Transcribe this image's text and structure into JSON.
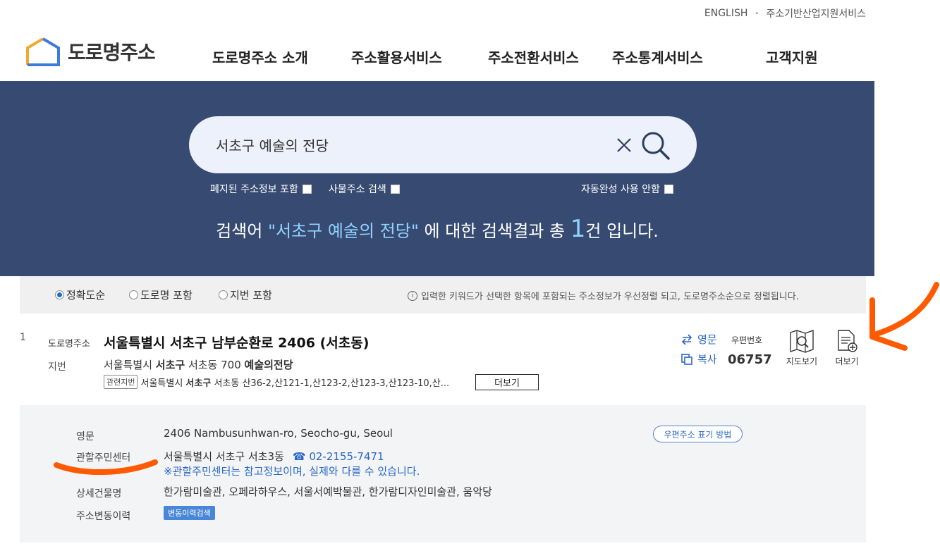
{
  "top_links": {
    "english": "ENGLISH",
    "industry": "주소기반산업지원서비스"
  },
  "logo": {
    "text": "도로명주소"
  },
  "gnb": [
    "도로명주소 소개",
    "주소활용서비스",
    "주소전환서비스",
    "주소통계서비스",
    "고객지원"
  ],
  "search": {
    "value": "서초구 예술의 전당",
    "options": {
      "abolished": "폐지된 주소정보 포함",
      "business": "사물주소 검색",
      "autocomplete": "자동완성 사용 안함"
    }
  },
  "result_message": {
    "prefix": "검색어 ",
    "keyword": "\"서초구 예술의 전당\"",
    "middle": " 에 대한 검색결과 총 ",
    "count": "1",
    "suffix": "건 입니다."
  },
  "sort": {
    "options": [
      "정확도순",
      "도로명 포함",
      "지번 포함"
    ],
    "selected": 0,
    "note": "입력한 키워드가 선택한 항목에 포함되는 주소정보가 우선정렬 되고, 도로명주소순으로 정렬됩니다."
  },
  "result": {
    "index": "1",
    "road_label": "도로명주소",
    "road_address": "서울특별시 서초구 남부순환로 2406 (서초동)",
    "jibun_label": "지번",
    "jibun_address": {
      "pre": "서울특별시 ",
      "b1": "서초구",
      "mid": " 서초동 700 ",
      "b2": "예술의전당"
    },
    "related_tag": "관련지번",
    "related": {
      "pre": "서울특별시 ",
      "bold": "서초구",
      "post": " 서초동 산36-2,산121-1,산123-2,산123-3,산123-10,산..."
    },
    "more_inline": "더보기",
    "english_link": "영문",
    "copy_link": "복사",
    "postal_label": "우편번호",
    "postal_code": "06757",
    "map_label": "지도보기",
    "more_label": "더보기"
  },
  "detail": {
    "eng_label": "영문",
    "eng_value": "2406 Nambusunhwan-ro, Seocho-gu, Seoul",
    "postal_btn": "우편주소 표기 방법",
    "center_label": "관할주민센터",
    "center_value": "서울특별시 서초구 서초3동",
    "center_phone": "02-2155-7471",
    "center_note": "※관할주민센터는 참고정보이며, 실제와 다를 수 있습니다.",
    "building_label": "상세건물명",
    "building_value": "한가람미술관, 오페라하우스, 서울서예박물관, 한가람디자인미술관, 움악당",
    "history_label": "주소변동이력",
    "history_btn": "변동이력검색"
  },
  "colors": {
    "hero_bg": "#374a72",
    "accent_blue": "#2b67c5",
    "annotation": "#ff5a00"
  }
}
